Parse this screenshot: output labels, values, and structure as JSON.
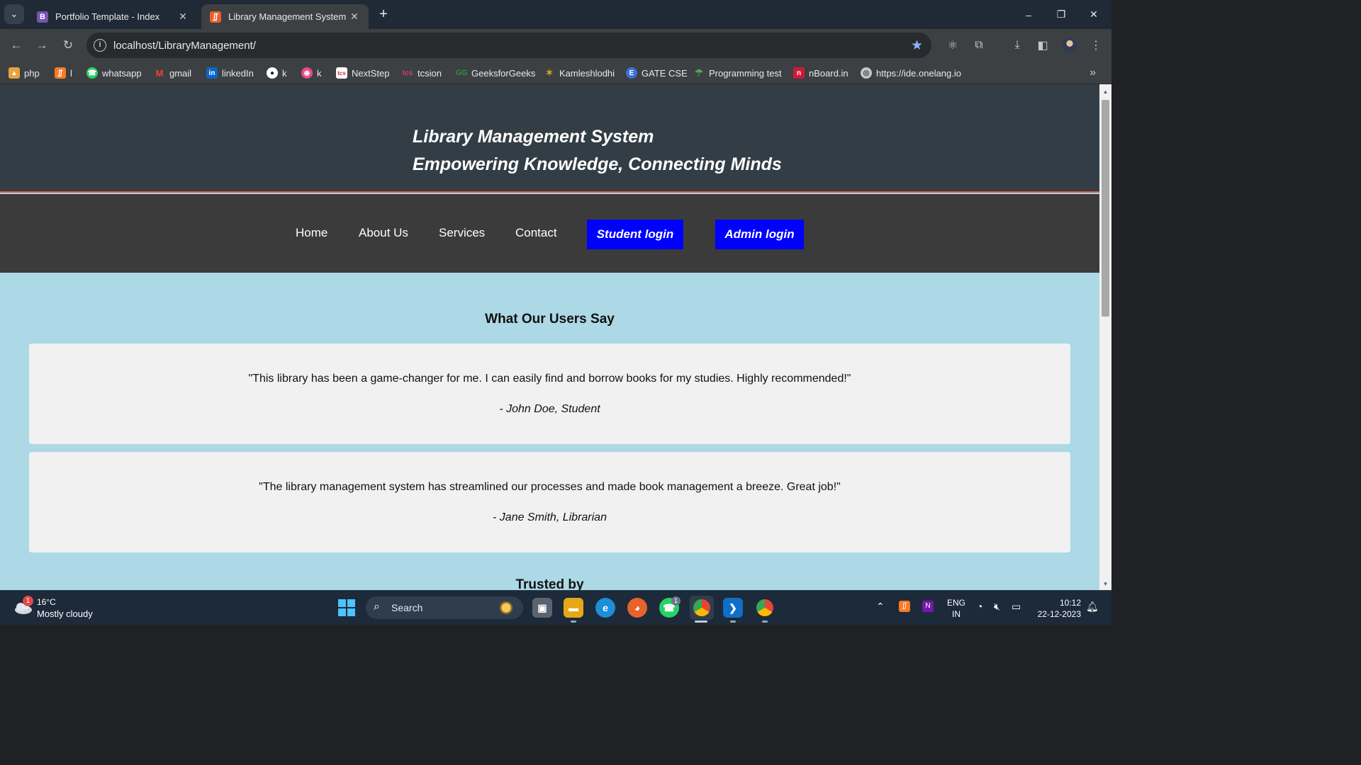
{
  "browser": {
    "tabs": [
      {
        "favicon_letter": "B",
        "favicon_color": "#7952b3",
        "title": "Portfolio Template - Index"
      },
      {
        "favicon_letter": "B",
        "favicon_color": "#e8612c",
        "title": "Library Management System"
      }
    ],
    "address": "localhost/LibraryManagement/",
    "bookmarks": [
      {
        "label": "php",
        "icon": "php-icon",
        "color": "#e8a33c"
      },
      {
        "label": "l",
        "icon": "xampp-icon",
        "color": "#fb7a24"
      },
      {
        "label": "whatsapp",
        "icon": "whatsapp-icon",
        "color": "#25d366"
      },
      {
        "label": "gmail",
        "icon": "gmail-icon",
        "color": "#ea4335"
      },
      {
        "label": "linkedIn",
        "icon": "linkedin-icon",
        "color": "#0a66c2"
      },
      {
        "label": "k",
        "icon": "github-icon",
        "color": "#ffffff"
      },
      {
        "label": "k",
        "icon": "swirl-icon",
        "color": "#e94a8a"
      },
      {
        "label": "NextStep",
        "icon": "tcs-icon",
        "color": "#e32636"
      },
      {
        "label": "tcsion",
        "icon": "tcsion-icon",
        "color": "#d83d72"
      },
      {
        "label": "GeeksforGeeks",
        "icon": "gfg-icon",
        "color": "#2f8d46"
      },
      {
        "label": "Kamleshlodhi",
        "icon": "kamlesh-icon",
        "color": "#c9a227"
      },
      {
        "label": "GATE CSE",
        "icon": "gate-icon",
        "color": "#3c6fd8"
      },
      {
        "label": "Programming test",
        "icon": "parachute-icon",
        "color": "#4cae4c"
      },
      {
        "label": "nBoard.in",
        "icon": "nboard-icon",
        "color": "#d0193a"
      },
      {
        "label": "https://ide.onelang.io",
        "icon": "globe-icon",
        "color": "#c4c7c5"
      }
    ]
  },
  "site": {
    "header": {
      "title": "Library Management System",
      "tagline": "Empowering Knowledge, Connecting Minds"
    },
    "nav": {
      "home": "Home",
      "about": "About Us",
      "services": "Services",
      "contact": "Contact",
      "student_login": "Student login",
      "admin_login": "Admin login"
    },
    "testimonials_title": "What Our Users Say",
    "testimonials": [
      {
        "quote": "\"This library has been a game-changer for me. I can easily find and borrow books for my studies. Highly recommended!\"",
        "author": "- John Doe, Student"
      },
      {
        "quote": "\"The library management system has streamlined our processes and made book management a breeze. Great job!\"",
        "author": "- Jane Smith, Librarian"
      }
    ],
    "trusted_title": "Trusted by",
    "colors": {
      "page_bg": "#add8e6",
      "header_bg": "#333d45",
      "header_border": "#e25b2c",
      "nav_bg": "#3b3b3b",
      "login_button": "#0000ff",
      "card_bg": "#f1f1f1"
    }
  },
  "taskbar": {
    "weather": {
      "temp": "16°C",
      "desc": "Mostly cloudy",
      "badge": "1"
    },
    "search_placeholder": "Search",
    "whatsapp_badge": "1",
    "lang_line1": "ENG",
    "lang_line2": "IN",
    "time": "10:12",
    "date": "22-12-2023"
  }
}
